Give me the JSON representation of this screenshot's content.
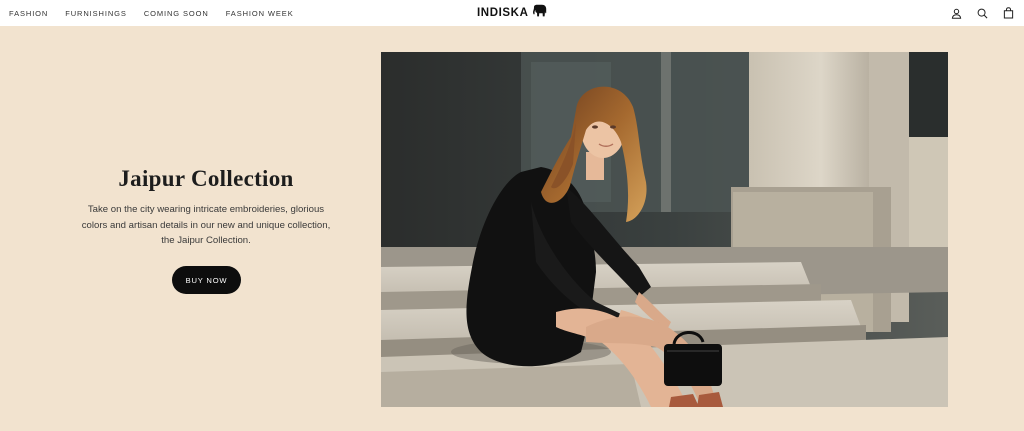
{
  "nav": {
    "items": [
      {
        "label": "FASHION"
      },
      {
        "label": "FURNISHINGS"
      },
      {
        "label": "COMING SOON"
      },
      {
        "label": "FASHION WEEK"
      }
    ]
  },
  "brand": {
    "name": "INDISKA",
    "logo_icon": "elephant-icon"
  },
  "header_icons": [
    "account-icon",
    "search-icon",
    "bag-icon"
  ],
  "hero": {
    "title": "Jaipur Collection",
    "description_line1": "Take on the city wearing intricate embroideries, glorious",
    "description_line2": "colors and artisan details in our new and unique collection,",
    "description_line3": "the Jaipur Collection.",
    "cta_label": "BUY NOW",
    "image_subject": "woman-in-black-dress-sitting-on-steps"
  },
  "colors": {
    "background": "#f2e3cf",
    "header": "#ffffff",
    "button": "#0d0d0d",
    "button_text": "#ffffff"
  }
}
